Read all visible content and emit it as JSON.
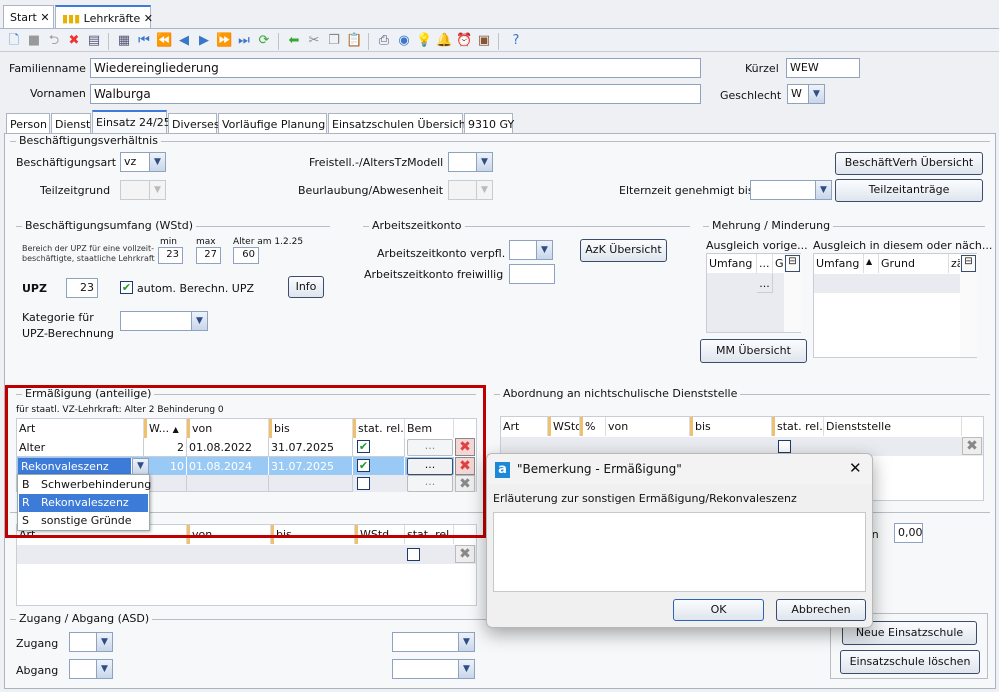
{
  "window_tabs": [
    {
      "label": "Start"
    },
    {
      "label": "Lehrkräfte",
      "active": true
    }
  ],
  "toolbar_icons": [
    "new-icon",
    "save-icon",
    "undo-icon",
    "delete-icon",
    "form-icon",
    "table-icon",
    "first-icon",
    "prev-page-icon",
    "prev-icon",
    "next-icon",
    "next-page-icon",
    "last-icon",
    "refresh-icon",
    "back-arrow-icon",
    "cut-icon",
    "copy-icon",
    "paste-icon",
    "print-icon",
    "preview-icon",
    "tip-icon",
    "bell-icon",
    "alarm-icon",
    "contact-icon",
    "help-icon"
  ],
  "header": {
    "familienname_label": "Familienname",
    "familienname": "Wiedereingliederung",
    "vornamen_label": "Vornamen",
    "vornamen": "Walburga",
    "kuerzel_label": "Kürzel",
    "kuerzel": "WEW",
    "geschlecht_label": "Geschlecht",
    "geschlecht": "W"
  },
  "subtabs": [
    "Person",
    "Dienst",
    "Einsatz 24/25",
    "Diverses",
    "Vorläufige Planung",
    "Einsatzschulen Übersicht",
    "9310 GY"
  ],
  "active_subtab": "Einsatz 24/25",
  "bv": {
    "legend": "Beschäftigungsverhältnis",
    "art_label": "Beschäftigungsart",
    "art": "vz",
    "tzgrund_label": "Teilzeitgrund",
    "freistell_label": "Freistell.-/AltersTzModell",
    "beurlaubung_label": "Beurlaubung/Abwesenheit",
    "elternzeit_label": "Elternzeit genehmigt bis",
    "btn_uebersicht": "BeschäftVerh Übersicht",
    "btn_teilzeit": "Teilzeitanträge"
  },
  "umfang": {
    "legend": "Beschäftigungsumfang (WStd)",
    "hint1": "Bereich der UPZ für eine vollzeit-",
    "hint2": "beschäftigte, staatliche Lehrkraft",
    "min_label": "min",
    "min": "23",
    "max_label": "max",
    "max": "27",
    "alter_label": "Alter am 1.2.25",
    "alter": "60",
    "upz_label": "UPZ",
    "upz": "23",
    "auto_label": "autom. Berechn. UPZ",
    "auto_checked": true,
    "info_btn": "Info",
    "kategorie_label1": "Kategorie für",
    "kategorie_label2": "UPZ-Berechnung"
  },
  "azk": {
    "legend": "Arbeitszeitkonto",
    "verpfl_label": "Arbeitszeitkonto verpfl.",
    "frei_label": "Arbeitszeitkonto freiwillig",
    "btn": "AzK Übersicht"
  },
  "mm": {
    "legend": "Mehrung / Minderung",
    "left_title": "Ausgleich vorige...",
    "left_cols": [
      "Umfang",
      "...",
      "Gr"
    ],
    "left_cell": "...",
    "right_title": "Ausgleich in diesem oder näch...",
    "right_cols": [
      "Umfang",
      "",
      "Grund",
      "zä"
    ],
    "btn": "MM Übersicht"
  },
  "erm": {
    "legend": "Ermäßigung (anteilige)",
    "hint": "für staatl. VZ-Lehrkraft: Alter 2 Behinderung 0",
    "cols": [
      "Art",
      "W...",
      "von",
      "bis",
      "stat. rel.",
      "Bem"
    ],
    "rows": [
      {
        "art": "Alter",
        "w": "2",
        "von": "01.08.2022",
        "bis": "31.07.2025",
        "stat": true,
        "bem": "..."
      },
      {
        "art": "Rekonvaleszenz",
        "w": "10",
        "von": "01.08.2024",
        "bis": "31.07.2025",
        "stat": true,
        "bem": "..."
      },
      {
        "art": "",
        "w": "",
        "von": "",
        "bis": "",
        "stat": false,
        "bem": "..."
      }
    ],
    "dropdown": [
      {
        "code": "B",
        "label": "Schwerbehinderung"
      },
      {
        "code": "R",
        "label": "Rekonvaleszenz",
        "selected": true
      },
      {
        "code": "S",
        "label": "sonstige Gründe"
      }
    ],
    "cols2": [
      "Art",
      "von",
      "bis",
      "WStd",
      "stat. rel."
    ]
  },
  "zugang": {
    "legend": "Zugang / Abgang (ASD)",
    "zugang_label": "Zugang",
    "abgang_label": "Abgang"
  },
  "abord": {
    "legend": "Abordnung an nichtschulische Dienststelle",
    "cols": [
      "Art",
      "WStd",
      "%",
      "von",
      "bis",
      "stat. rel.",
      "Dienststelle"
    ]
  },
  "right": {
    "partial_label": "en",
    "value": "0,00",
    "btn_neu": "Neue Einsatzschule",
    "btn_loeschen": "Einsatzschule löschen"
  },
  "dialog": {
    "title": "\"Bemerkung - Ermäßigung\"",
    "label": "Erläuterung zur sonstigen Ermäßigung/Rekonvaleszenz",
    "text": "",
    "ok": "OK",
    "cancel": "Abbrechen"
  },
  "colors": {
    "highlight": "#3d7bd9",
    "selected_row": "#99c9f5",
    "red_frame": "#c00000"
  }
}
